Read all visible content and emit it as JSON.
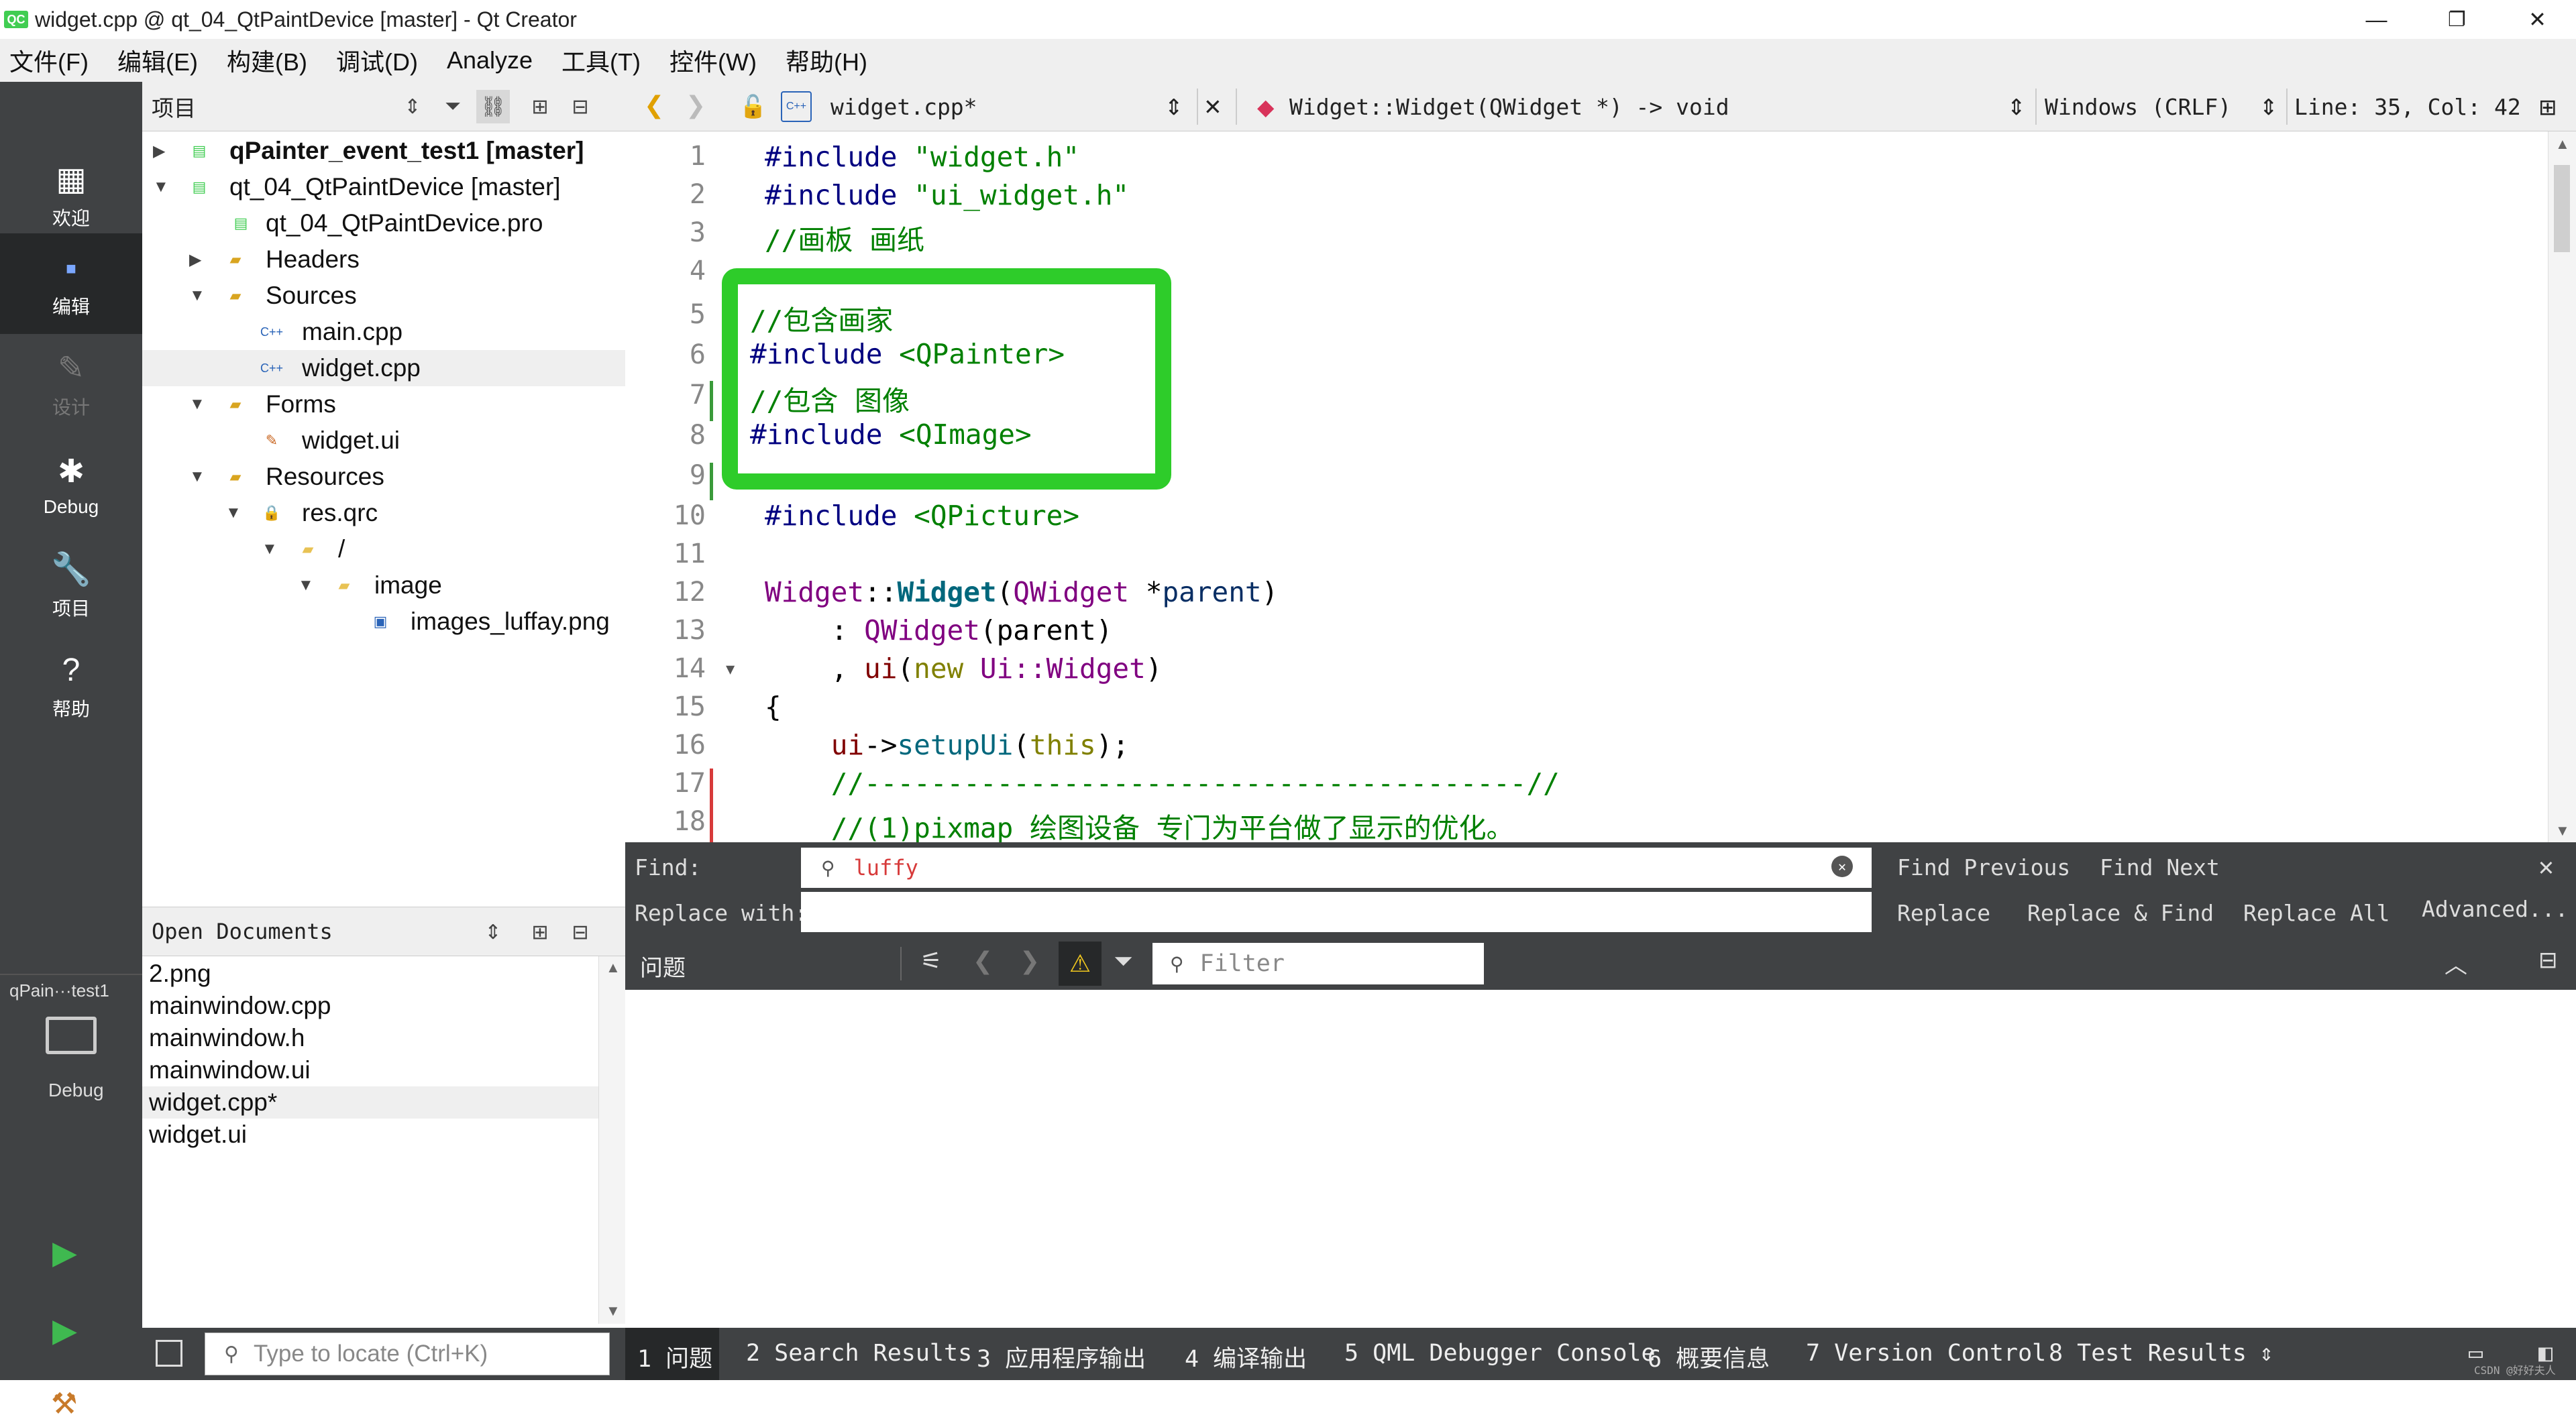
{
  "window": {
    "title": "widget.cpp @ qt_04_QtPaintDevice [master] - Qt Creator",
    "app_icon": "QC",
    "minimize": "—",
    "restore": "❐",
    "close": "✕"
  },
  "menu": [
    "文件(F)",
    "编辑(E)",
    "构建(B)",
    "调试(D)",
    "Analyze",
    "工具(T)",
    "控件(W)",
    "帮助(H)"
  ],
  "modes": {
    "welcome": "欢迎",
    "edit": "编辑",
    "design": "设计",
    "debug": "Debug",
    "projects": "项目",
    "help": "帮助"
  },
  "kit": {
    "project": "qPain···test1",
    "config": "Debug"
  },
  "project_panel": {
    "title": "项目",
    "tree": [
      {
        "label": "qPainter_event_test1 [master]",
        "bold": true,
        "icon": "qt-project-icon"
      },
      {
        "label": "qt_04_QtPaintDevice [master]",
        "icon": "qt-project-icon"
      },
      {
        "label": "qt_04_QtPaintDevice.pro",
        "icon": "pro-file-icon"
      },
      {
        "label": "Headers",
        "icon": "headers-folder-icon"
      },
      {
        "label": "Sources",
        "icon": "sources-folder-icon"
      },
      {
        "label": "main.cpp",
        "icon": "cpp-file-icon"
      },
      {
        "label": "widget.cpp",
        "icon": "cpp-file-icon",
        "selected": true
      },
      {
        "label": "Forms",
        "icon": "forms-folder-icon"
      },
      {
        "label": "widget.ui",
        "icon": "ui-file-icon"
      },
      {
        "label": "Resources",
        "icon": "resources-folder-icon"
      },
      {
        "label": "res.qrc",
        "icon": "qrc-file-icon"
      },
      {
        "label": "/",
        "icon": "folder-icon"
      },
      {
        "label": "image",
        "icon": "folder-icon"
      },
      {
        "label": "images_luffay.png",
        "icon": "image-file-icon"
      }
    ]
  },
  "open_documents": {
    "title": "Open Documents",
    "items": [
      "2.png",
      "mainwindow.cpp",
      "mainwindow.h",
      "mainwindow.ui",
      "widget.cpp*",
      "widget.ui"
    ]
  },
  "locate": {
    "placeholder": "Type to locate (Ctrl+K)"
  },
  "editor": {
    "file": "widget.cpp*",
    "symbol": "Widget::Widget(QWidget *) -> void",
    "line_ending": "Windows (CRLF)",
    "position": "Line: 35, Col: 42",
    "line_numbers": [
      "1",
      "2",
      "3",
      "4",
      "5",
      "6",
      "7",
      "8",
      "9",
      "10",
      "11",
      "12",
      "13",
      "14",
      "15",
      "16",
      "17",
      "18"
    ],
    "lines": {
      "l1": {
        "a": "#include ",
        "b": "\"widget.h\""
      },
      "l2": {
        "a": "#include ",
        "b": "\"ui_widget.h\""
      },
      "l3": "//画板 画纸",
      "l5": "//包含画家",
      "l6": {
        "a": "#include ",
        "b": "<QPainter>"
      },
      "l7": "//包含 图像",
      "l8": {
        "a": "#include ",
        "b": "<QImage>"
      },
      "l10": {
        "a": "#include ",
        "b": "<QPicture>"
      },
      "l12": {
        "a": "Widget",
        "b": "::",
        "c": "Widget",
        "d": "(",
        "e": "QWidget",
        "f": " *",
        "g": "parent",
        "h": ")"
      },
      "l13": {
        "a": "    : ",
        "b": "QWidget",
        "c": "(parent)"
      },
      "l14": {
        "a": "    , ",
        "b": "ui",
        "c": "(",
        "d": "new",
        "e": " Ui::",
        "f": "Widget",
        "g": ")"
      },
      "l15": "{",
      "l16": {
        "a": "    ",
        "b": "ui",
        "c": "->",
        "d": "setupUi",
        "e": "(",
        "f": "this",
        "g": ");"
      },
      "l17": "    //----------------------------------------//",
      "l18": "    //(1)pixmap 绘图设备 专门为平台做了显示的优化。"
    }
  },
  "find": {
    "find_label": "Find:",
    "replace_label": "Replace with:",
    "query": "luffy",
    "replace_value": "",
    "find_previous": "Find Previous",
    "find_next": "Find Next",
    "replace": "Replace",
    "replace_find": "Replace & Find",
    "replace_all": "Replace All",
    "advanced": "Advanced..."
  },
  "issues": {
    "title": "问题",
    "filter_placeholder": "Filter"
  },
  "output_tabs": [
    "1  问题",
    "2  Search Results",
    "3  应用程序输出",
    "4  编译输出",
    "5  QML Debugger Console",
    "6  概要信息",
    "7  Version Control",
    "8  Test Results"
  ],
  "watermark": "CSDN @好好夫人",
  "colors": {
    "highlight_box": "#2ecc2a",
    "mode_bar": "#404244",
    "keyword": "#808000",
    "preprocessor": "#000080",
    "comment": "#008000"
  }
}
